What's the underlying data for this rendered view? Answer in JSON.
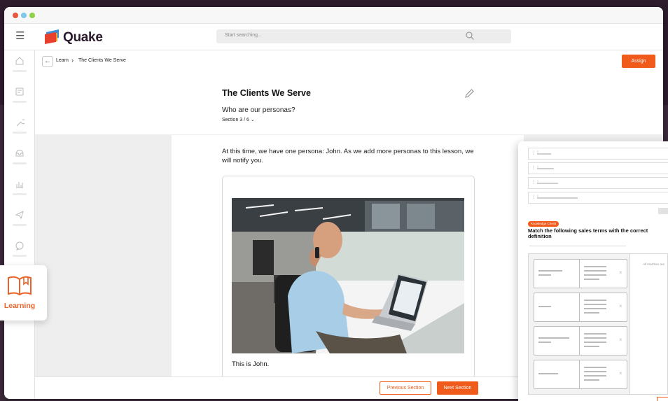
{
  "brand": {
    "name": "Quake",
    "accent": "#f05a1a",
    "logo_colors": [
      "#e8402c",
      "#3b8fd6",
      "#f0a02a"
    ]
  },
  "window_controls": [
    {
      "name": "close",
      "color": "#e8563f"
    },
    {
      "name": "minimize",
      "color": "#7fc8e8"
    },
    {
      "name": "maximize",
      "color": "#8dd14a"
    }
  ],
  "search": {
    "placeholder": "Start searching..."
  },
  "sidebar": {
    "items": [
      {
        "icon": "home-icon"
      },
      {
        "icon": "notes-icon"
      },
      {
        "icon": "tools-icon"
      },
      {
        "icon": "inbox-icon"
      },
      {
        "icon": "analytics-icon"
      },
      {
        "icon": "send-icon"
      },
      {
        "icon": "chat-icon"
      }
    ]
  },
  "breadcrumb": {
    "items": [
      "Learn",
      "The Clients We Serve"
    ]
  },
  "header": {
    "assign_label": "Assign"
  },
  "lesson": {
    "title": "The Clients We Serve",
    "subtitle": "Who are our personas?",
    "section_label": "Section 3 / 6",
    "paragraph": "At this time, we have one persona: John. As we add more personas to this lesson, we will notify you.",
    "caption": "This is John."
  },
  "footer": {
    "prev_label": "Previous Section",
    "next_label": "Next Section"
  },
  "learning_card": {
    "label": "Learning",
    "icon": "book-icon"
  },
  "knowledge_check": {
    "badge": "Knowledge Check",
    "title": "Match the following sales terms with the correct definition",
    "right_note": "All matches are"
  }
}
